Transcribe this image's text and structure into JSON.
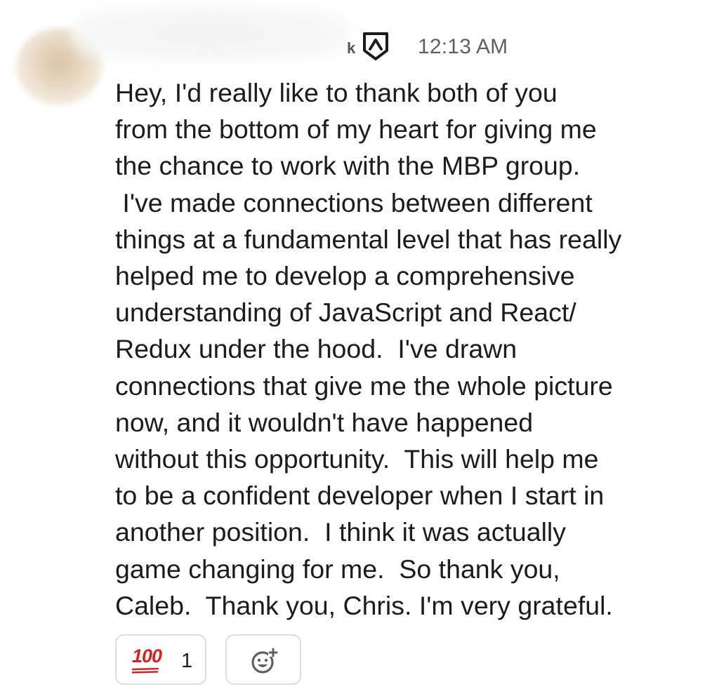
{
  "message": {
    "author_suffix": "k",
    "timestamp": "12:13 AM",
    "lines": [
      "Hey, I'd really like to thank both of you",
      "from the bottom of my heart for giving me",
      "the chance to work with the MBP group.",
      " I've made connections between different",
      "things at a fundamental level that has really",
      "helped me to develop a comprehensive",
      "understanding of JavaScript and React/",
      "Redux under the hood.  I've drawn",
      "connections that give me the whole picture",
      "now, and it wouldn't have happened",
      "without this opportunity.  This will help me",
      "to be a confident developer when I start in",
      "another position.  I think it was actually",
      "game changing for me.  So thank you,",
      "Caleb.  Thank you, Chris. I'm very grateful."
    ]
  },
  "reactions": [
    {
      "emoji": "100",
      "icon": "hundred-points-emoji",
      "count": "1",
      "color": "#d0251f"
    }
  ],
  "add_reaction": {
    "icon": "add-reaction-icon"
  },
  "badge": {
    "icon": "app-badge-icon"
  },
  "colors": {
    "text": "#1d1c1d",
    "timestamp": "#616061",
    "reaction_border": "#dcdcdc",
    "hundred_red": "#d0251f"
  }
}
